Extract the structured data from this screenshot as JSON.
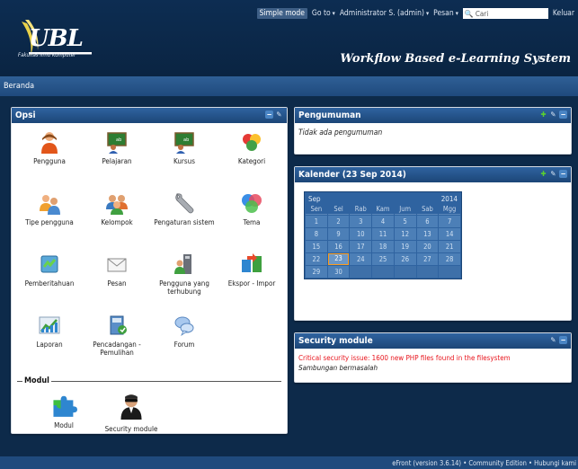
{
  "topbar": {
    "simple_mode": "Simple mode",
    "goto": "Go to",
    "user": "Administrator S. (admin)",
    "messages": "Pesan",
    "search_placeholder": "Cari",
    "logout": "Keluar"
  },
  "brand": {
    "logo_text": "UBL",
    "logo_sub": "Fakultas Ilmu Komputer",
    "site_title": "Workflow Based e-Learning System",
    "accent": "#2f63a0"
  },
  "nav": {
    "breadcrumb": "Beranda"
  },
  "opsi": {
    "title": "Opsi",
    "items": [
      {
        "label": "Pengguna",
        "icon": "user-icon"
      },
      {
        "label": "Pelajaran",
        "icon": "blackboard-icon"
      },
      {
        "label": "Kursus",
        "icon": "blackboard-icon"
      },
      {
        "label": "Kategori",
        "icon": "category-icon"
      },
      {
        "label": "Tipe pengguna",
        "icon": "user-types-icon"
      },
      {
        "label": "Kelompok",
        "icon": "group-icon"
      },
      {
        "label": "Pengaturan sistem",
        "icon": "wrench-icon"
      },
      {
        "label": "Tema",
        "icon": "theme-icon"
      },
      {
        "label": "Pemberitahuan",
        "icon": "notification-icon"
      },
      {
        "label": "Pesan",
        "icon": "envelope-icon"
      },
      {
        "label": "Pengguna yang terhubung",
        "icon": "connected-users-icon"
      },
      {
        "label": "Ekspor - Impor",
        "icon": "export-import-icon"
      },
      {
        "label": "Laporan",
        "icon": "report-chart-icon"
      },
      {
        "label": "Pencadangan - Pemulihan",
        "icon": "backup-icon"
      },
      {
        "label": "Forum",
        "icon": "forum-icon"
      }
    ],
    "modul_heading": "Modul",
    "modul_items": [
      {
        "label": "Modul",
        "icon": "puzzle-icon"
      },
      {
        "label": "Security module",
        "icon": "security-agent-icon"
      }
    ]
  },
  "announcements": {
    "title": "Pengumuman",
    "empty_text": "Tidak ada pengumuman"
  },
  "calendar": {
    "title": "Kalender (23 Sep 2014)",
    "month": "Sep",
    "year": "2014",
    "day_names": [
      "Sen",
      "Sel",
      "Rab",
      "Kam",
      "Jum",
      "Sab",
      "Mgg"
    ],
    "days": [
      "1",
      "2",
      "3",
      "4",
      "5",
      "6",
      "7",
      "8",
      "9",
      "10",
      "11",
      "12",
      "13",
      "14",
      "15",
      "16",
      "17",
      "18",
      "19",
      "20",
      "21",
      "22",
      "23",
      "24",
      "25",
      "26",
      "27",
      "28",
      "29",
      "30"
    ],
    "today": "23"
  },
  "security": {
    "title": "Security module",
    "alert": "Critical security issue: 1600 new PHP files found in the filesystem",
    "status": "Sambungan bermasalah",
    "alert_color": "#e8141c"
  },
  "footer": {
    "text": "eFront (version 3.6.14) • Community Edition • Hubungi kami"
  }
}
